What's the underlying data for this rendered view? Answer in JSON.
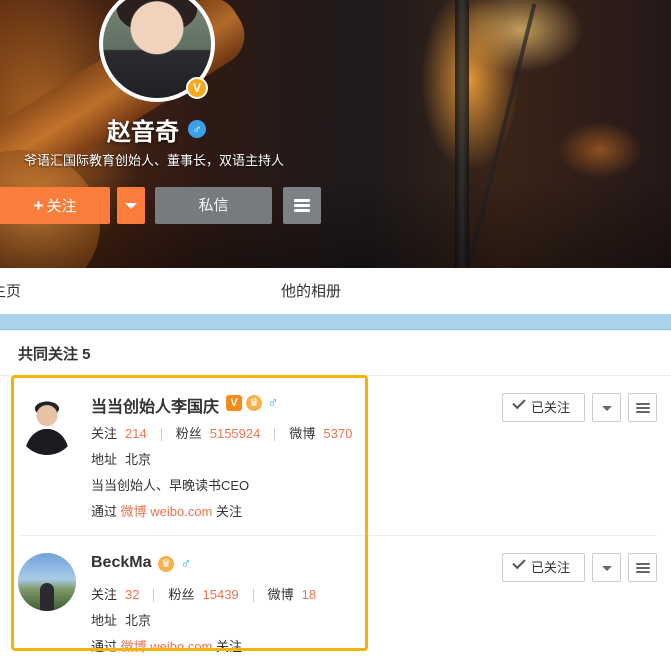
{
  "profile": {
    "name": "赵音奇",
    "verified_icon": "V",
    "gender_icon": "♂",
    "description": "爷语汇国际教育创始人、董事长，双语主持人",
    "follow_label": "关注",
    "follow_plus": "+",
    "message_label": "私信"
  },
  "tabs": {
    "home": "主页",
    "album": "他的相册"
  },
  "common_follow": {
    "title": "共同关注 5",
    "users": [
      {
        "name": "当当创始人李国庆",
        "badges": [
          "V",
          "♛",
          "♂"
        ],
        "follow_label": "关注",
        "follow_value": "214",
        "fans_label": "粉丝",
        "fans_value": "5155924",
        "weibo_label": "微博",
        "weibo_value": "5370",
        "location_label": "地址",
        "location_value": "北京",
        "bio": "当当创始人、早晚读书CEO",
        "via_prefix": "通过",
        "via_link": "微博 weibo.com",
        "via_suffix": "关注",
        "followed_label": "已关注"
      },
      {
        "name": "BeckMa",
        "badges": [
          "♛",
          "♂"
        ],
        "follow_label": "关注",
        "follow_value": "32",
        "fans_label": "粉丝",
        "fans_value": "15439",
        "weibo_label": "微博",
        "weibo_value": "18",
        "location_label": "地址",
        "location_value": "北京",
        "via_prefix": "通过",
        "via_link": "微博 weibo.com",
        "via_suffix": "关注",
        "followed_label": "已关注"
      }
    ]
  },
  "colors": {
    "follow_orange": "#fa7d3c",
    "stat_value": "#eb7350",
    "highlight": "#f5b400",
    "male_blue": "#3aa0e8"
  }
}
